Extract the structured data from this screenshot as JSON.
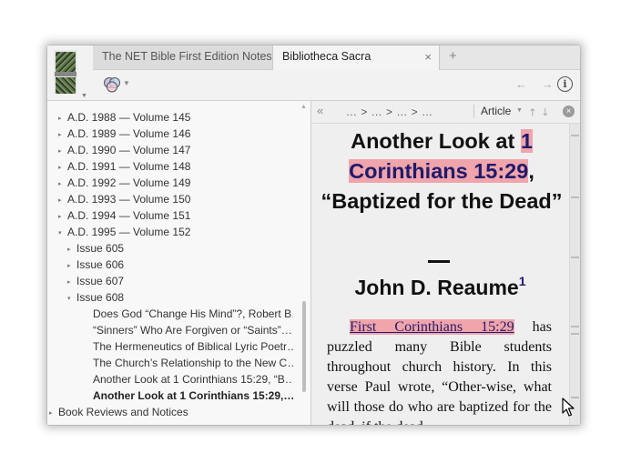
{
  "tabs": [
    {
      "label": "The NET Bible First Edition Notes",
      "active": false
    },
    {
      "label": "Bibliotheca Sacra",
      "active": true,
      "close": "×"
    }
  ],
  "tab_add": "+",
  "toolbar": {
    "back_forward": "← →",
    "info": "i"
  },
  "tree": [
    {
      "label": "A.D. 1988 — Volume 145",
      "indent": 0,
      "expander": "▸"
    },
    {
      "label": "A.D. 1989 — Volume 146",
      "indent": 0,
      "expander": "▸"
    },
    {
      "label": "A.D. 1990 — Volume 147",
      "indent": 0,
      "expander": "▸"
    },
    {
      "label": "A.D. 1991 — Volume 148",
      "indent": 0,
      "expander": "▸"
    },
    {
      "label": "A.D. 1992 — Volume 149",
      "indent": 0,
      "expander": "▸"
    },
    {
      "label": "A.D. 1993 — Volume 150",
      "indent": 0,
      "expander": "▸"
    },
    {
      "label": "A.D. 1994 — Volume 151",
      "indent": 0,
      "expander": "▸"
    },
    {
      "label": "A.D. 1995 — Volume 152",
      "indent": 0,
      "expander": "▾"
    },
    {
      "label": "Issue 605",
      "indent": 1,
      "expander": "▸"
    },
    {
      "label": "Issue 606",
      "indent": 1,
      "expander": "▸"
    },
    {
      "label": "Issue 607",
      "indent": 1,
      "expander": "▸"
    },
    {
      "label": "Issue 608",
      "indent": 1,
      "expander": "▾"
    },
    {
      "label": "Does God “Change His Mind”?, Robert B…",
      "indent": 2,
      "expander": ""
    },
    {
      "label": "“Sinners” Who Are Forgiven or “Saints”…",
      "indent": 2,
      "expander": ""
    },
    {
      "label": "The Hermeneutics of Biblical Lyric Poetr…",
      "indent": 2,
      "expander": ""
    },
    {
      "label": "The Church’s Relationship to the New C…",
      "indent": 2,
      "expander": ""
    },
    {
      "label": "Another Look at 1 Corinthians 15:29, “B…",
      "indent": 2,
      "expander": ""
    },
    {
      "label": "Another Look at 1 Corinthians 15:29,…",
      "indent": 2,
      "expander": "",
      "bold": true
    },
    {
      "label": "Book Reviews and Notices",
      "indent": -1,
      "expander": "▸"
    }
  ],
  "reader": {
    "collapse": "«",
    "breadcrumb": "… > … > … > …",
    "view_mode": "Article",
    "title_pre": "Another Look at ",
    "title_hl": "1 Corinthians 15:29",
    "title_post": ", “Baptized for the Dead”",
    "author": "John D. Reaume",
    "footnote": "1",
    "para_link": "First Corinthians 15:29",
    "para_text": " has puzzled many Bible students throughout church history. In this verse Paul wrote, “Other-wise, what will those do who are baptized for the dead, if the dead"
  }
}
